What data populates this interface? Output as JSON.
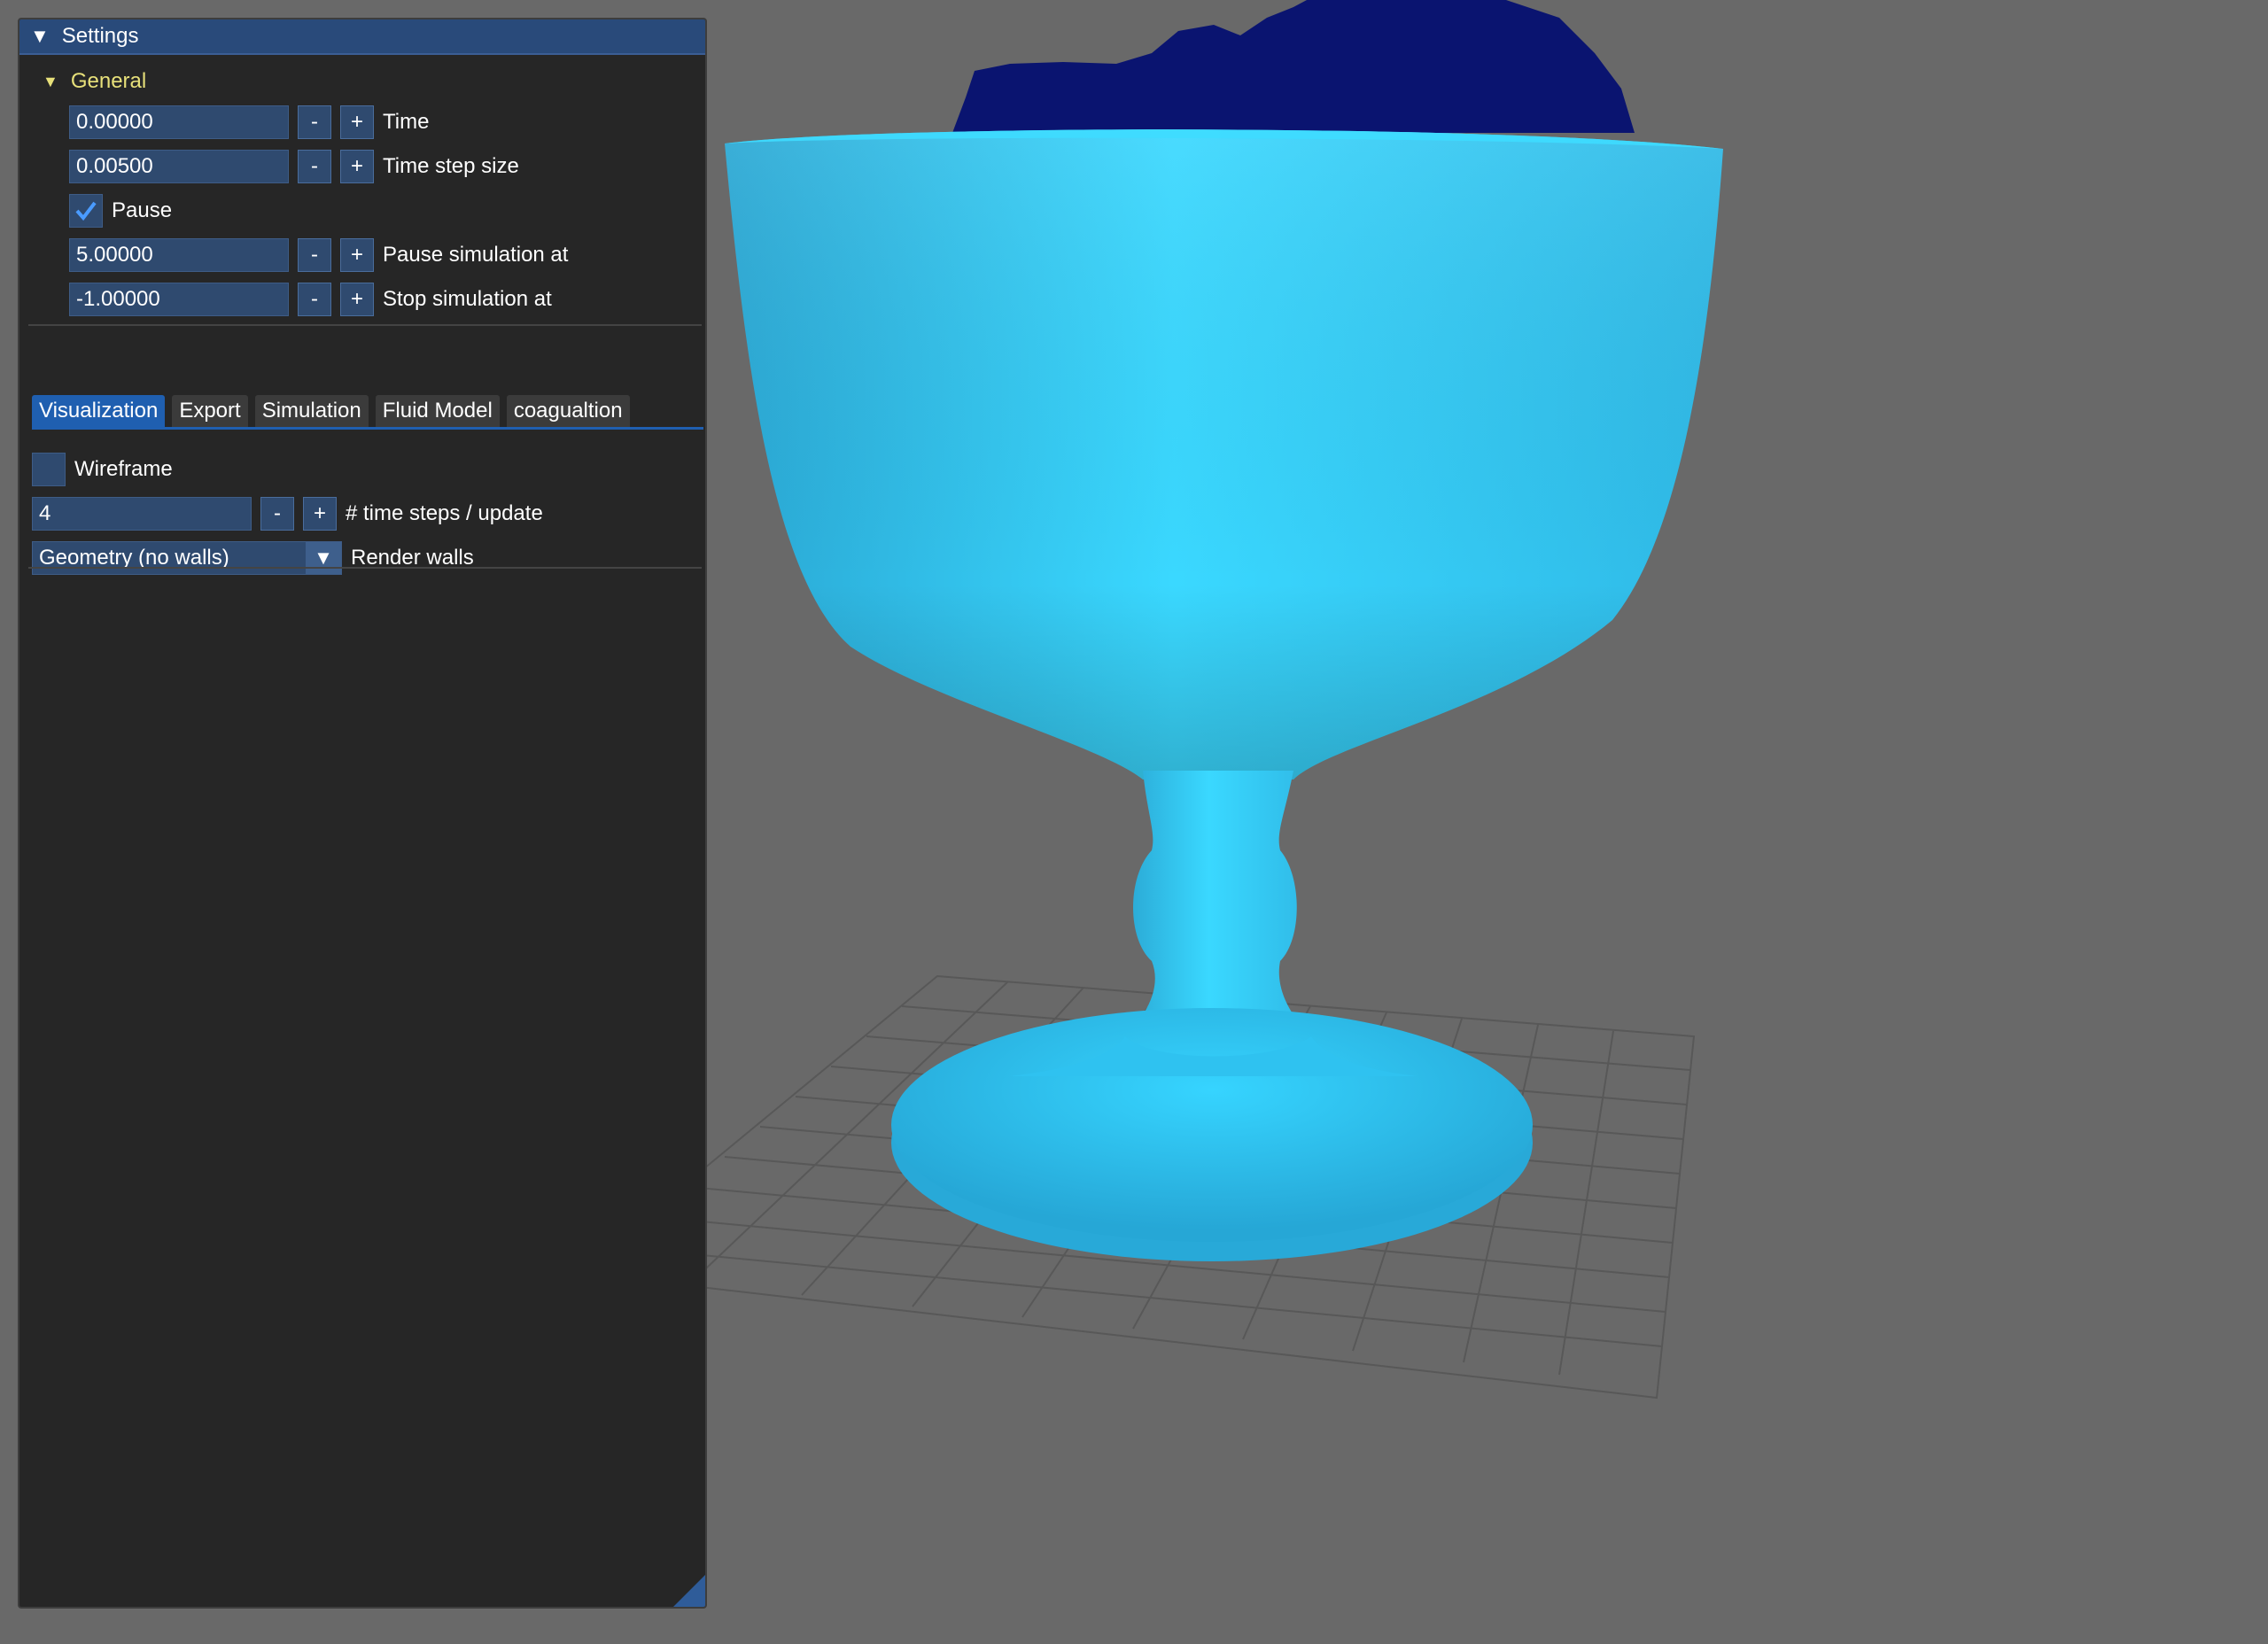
{
  "panel": {
    "title": "Settings",
    "general": {
      "header": "General",
      "time": {
        "value": "0.00000",
        "minus": "-",
        "plus": "+",
        "label": "Time"
      },
      "time_step": {
        "value": "0.00500",
        "minus": "-",
        "plus": "+",
        "label": "Time step size"
      },
      "pause": {
        "checked": true,
        "label": "Pause"
      },
      "pause_at": {
        "value": "5.00000",
        "minus": "-",
        "plus": "+",
        "label": "Pause simulation at"
      },
      "stop_at": {
        "value": "-1.00000",
        "minus": "-",
        "plus": "+",
        "label": "Stop simulation at"
      }
    },
    "tabs": [
      {
        "label": "Visualization",
        "active": true
      },
      {
        "label": "Export",
        "active": false
      },
      {
        "label": "Simulation",
        "active": false
      },
      {
        "label": "Fluid Model",
        "active": false
      },
      {
        "label": "coagualtion",
        "active": false
      }
    ],
    "visualization": {
      "wireframe": {
        "checked": false,
        "label": "Wireframe"
      },
      "steps": {
        "value": "4",
        "minus": "-",
        "plus": "+",
        "label": "# time steps / update"
      },
      "render_walls": {
        "value": "Geometry (no walls)",
        "label": "Render walls"
      }
    }
  },
  "scene": {
    "background": "#696969",
    "object": "goblet",
    "object_color": "#33d2fb",
    "particle_color": "#0a1470"
  },
  "colors": {
    "accent": "#1f5fb0",
    "title_bar": "#294a7a",
    "section_header": "#e7e07a"
  }
}
